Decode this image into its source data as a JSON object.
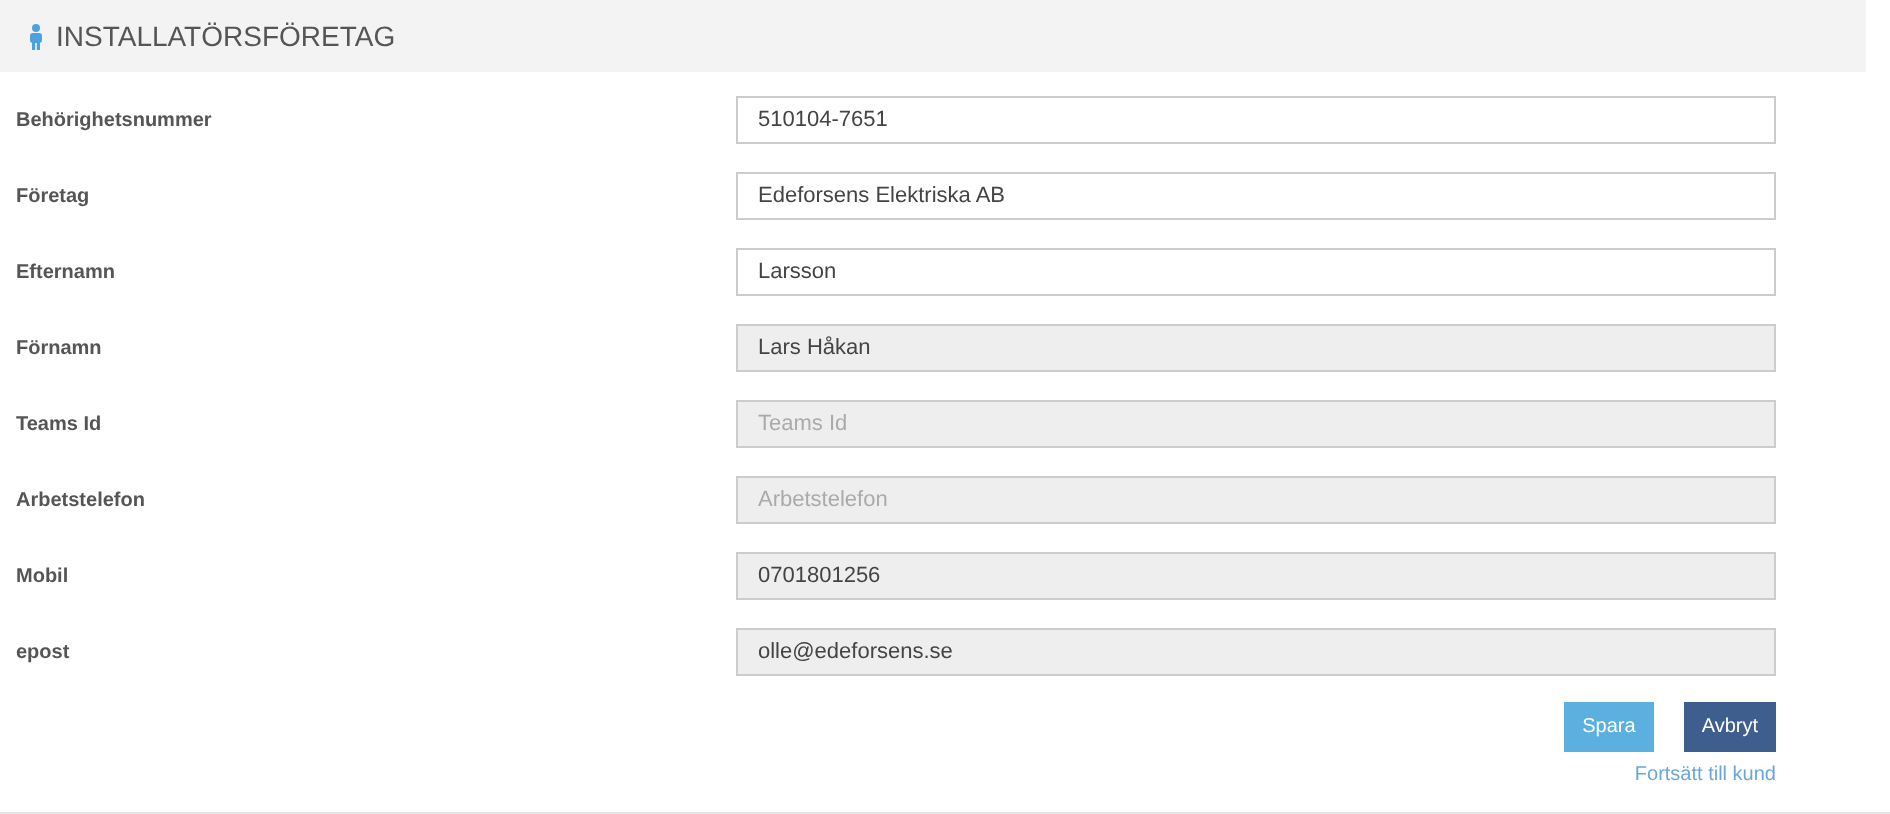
{
  "header": {
    "title": "INSTALLATÖRSFÖRETAG"
  },
  "fields": [
    {
      "label": "Behörighetsnummer",
      "value": "510104-7651",
      "disabled": false
    },
    {
      "label": "Företag",
      "value": "Edeforsens Elektriska AB",
      "disabled": false
    },
    {
      "label": "Efternamn",
      "value": "Larsson",
      "disabled": false
    },
    {
      "label": "Förnamn",
      "value": "Lars Håkan",
      "disabled": true
    },
    {
      "label": "Teams Id",
      "placeholder": "Teams Id",
      "disabled": true
    },
    {
      "label": "Arbetstelefon",
      "placeholder": "Arbetstelefon",
      "disabled": true
    },
    {
      "label": "Mobil",
      "value": "0701801256",
      "disabled": true
    },
    {
      "label": "epost",
      "value": "olle@edeforsens.se",
      "disabled": true
    }
  ],
  "buttons": [
    {
      "label": "Spara",
      "kind": "primary"
    },
    {
      "label": "Avbryt",
      "kind": "secondary"
    }
  ],
  "link": "Fortsätt till kund"
}
